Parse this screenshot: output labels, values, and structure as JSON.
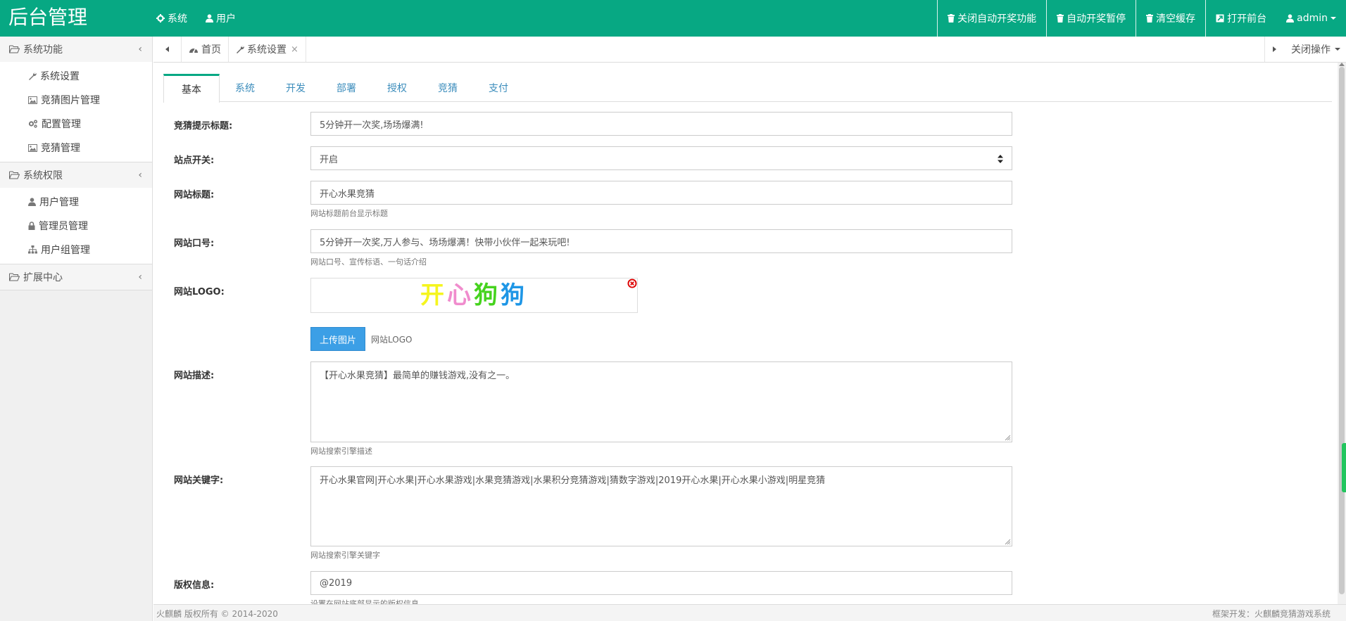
{
  "header": {
    "brand": "后台管理",
    "nav": [
      {
        "label": "系统",
        "icon": "gear-icon"
      },
      {
        "label": "用户",
        "icon": "user-icon"
      }
    ],
    "actions": [
      {
        "label": "关闭自动开奖功能",
        "icon": "trash-icon"
      },
      {
        "label": "自动开奖暂停",
        "icon": "trash-icon"
      },
      {
        "label": "清空缓存",
        "icon": "trash-icon"
      },
      {
        "label": "打开前台",
        "icon": "external-link-icon"
      }
    ],
    "user": {
      "label": "admin",
      "icon": "user-icon"
    }
  },
  "sidebar": {
    "groups": [
      {
        "title": "系统功能",
        "items": [
          {
            "label": "系统设置",
            "icon": "wrench-icon"
          },
          {
            "label": "竞猜图片管理",
            "icon": "image-icon"
          },
          {
            "label": "配置管理",
            "icon": "cogs-icon"
          },
          {
            "label": "竞猜管理",
            "icon": "image-icon"
          }
        ]
      },
      {
        "title": "系统权限",
        "items": [
          {
            "label": "用户管理",
            "icon": "user-icon"
          },
          {
            "label": "管理员管理",
            "icon": "lock-icon"
          },
          {
            "label": "用户组管理",
            "icon": "sitemap-icon"
          }
        ]
      },
      {
        "title": "扩展中心",
        "items": []
      }
    ]
  },
  "tabstrip": {
    "tabs": [
      {
        "label": "首页",
        "icon": "dashboard-icon"
      },
      {
        "label": "系统设置",
        "icon": "wrench-icon",
        "close": "×"
      }
    ],
    "close_ops": "关闭操作"
  },
  "subtabs": [
    "基本",
    "系统",
    "开发",
    "部署",
    "授权",
    "竞猜",
    "支付"
  ],
  "form": {
    "guess_title": {
      "label": "竞猜提示标题:",
      "value": "5分钟开一次奖,场场爆满!"
    },
    "site_switch": {
      "label": "站点开关:",
      "value": "开启"
    },
    "site_title": {
      "label": "网站标题:",
      "value": "开心水果竞猜",
      "help": "网站标题前台显示标题"
    },
    "slogan": {
      "label": "网站口号:",
      "value": "5分钟开一次奖,万人参与、场场爆满！快带小伙伴一起来玩吧!",
      "help": "网站口号、宣传标语、一句话介绍"
    },
    "logo": {
      "label": "网站LOGO:",
      "logo_chars": [
        "开",
        "心",
        "狗",
        "狗"
      ],
      "upload_label": "上传图片",
      "upload_hint": "网站LOGO"
    },
    "description": {
      "label": "网站描述:",
      "value": "【开心水果竞猜】最简单的赚钱游戏,没有之一。",
      "help": "网站搜索引擎描述"
    },
    "keywords": {
      "label": "网站关键字:",
      "value": "开心水果官网|开心水果|开心水果游戏|水果竞猜游戏|水果积分竞猜游戏|猜数字游戏|2019开心水果|开心水果小游戏|明星竞猜",
      "help": "网站搜索引擎关键字"
    },
    "copyright": {
      "label": "版权信息:",
      "value": "@2019",
      "help": "设置在网站底部显示的版权信息"
    }
  },
  "footer": {
    "left": "火麒麟 版权所有 © 2014-2020",
    "right": "框架开发：火麒麟竞猜游戏系统"
  },
  "colors": {
    "primary": "#07a883",
    "link": "#3c8dbc",
    "upload": "#3c9fe6"
  }
}
